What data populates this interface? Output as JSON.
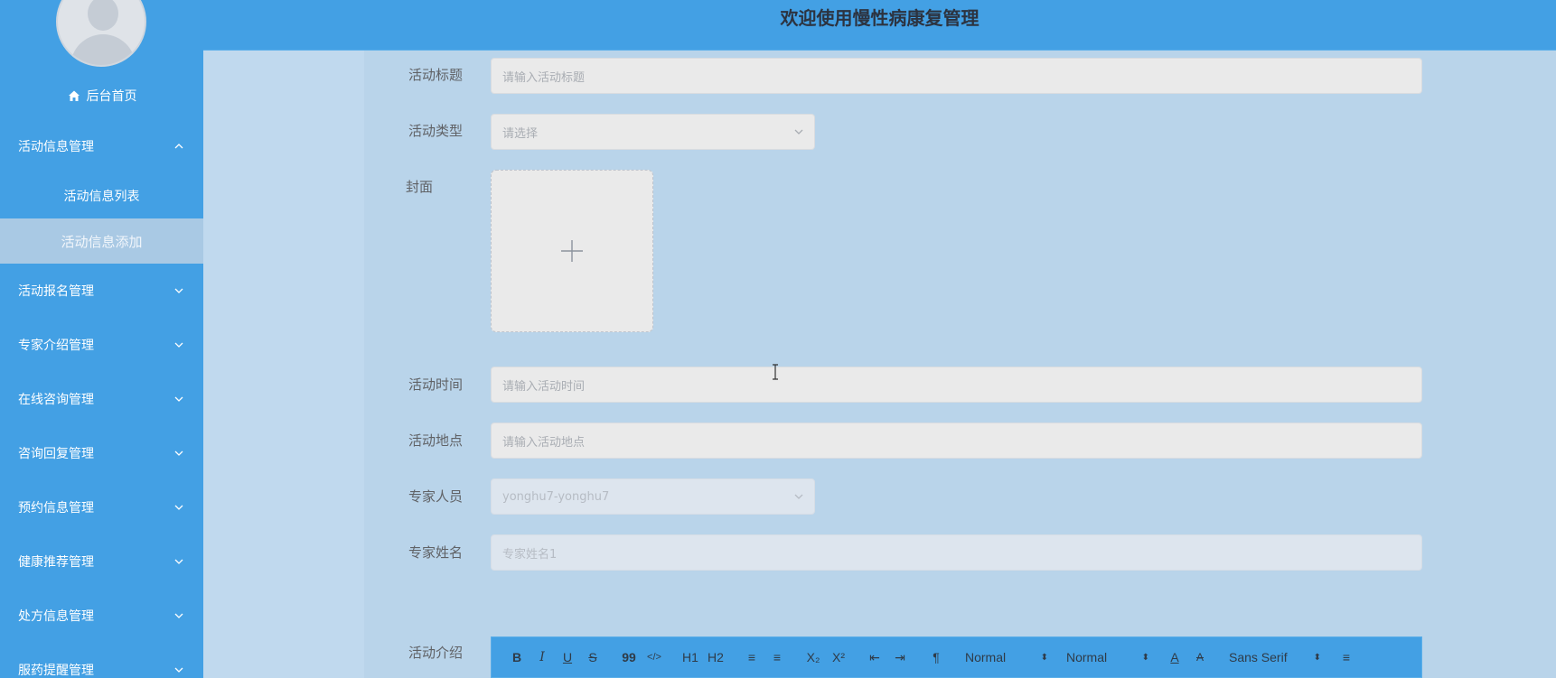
{
  "header": {
    "title": "欢迎使用慢性病康复管理"
  },
  "sidebar": {
    "home_label": "后台首页",
    "groups": [
      {
        "label": "活动信息管理",
        "expanded": true
      },
      {
        "label": "活动报名管理",
        "expanded": false
      },
      {
        "label": "专家介绍管理",
        "expanded": false
      },
      {
        "label": "在线咨询管理",
        "expanded": false
      },
      {
        "label": "咨询回复管理",
        "expanded": false
      },
      {
        "label": "预约信息管理",
        "expanded": false
      },
      {
        "label": "健康推荐管理",
        "expanded": false
      },
      {
        "label": "处方信息管理",
        "expanded": false
      },
      {
        "label": "服药提醒管理",
        "expanded": false
      }
    ],
    "sub_items": [
      {
        "label": "活动信息列表",
        "active": false
      },
      {
        "label": "活动信息添加",
        "active": true
      }
    ]
  },
  "form": {
    "title_label": "活动标题",
    "title_placeholder": "请输入活动标题",
    "type_label": "活动类型",
    "type_placeholder": "请选择",
    "cover_label": "封面",
    "time_label": "活动时间",
    "time_placeholder": "请输入活动时间",
    "location_label": "活动地点",
    "location_placeholder": "请输入活动地点",
    "expert_label": "专家人员",
    "expert_value": "yonghu7-yonghu7",
    "expert_name_label": "专家姓名",
    "expert_name_value": "专家姓名1",
    "intro_label": "活动介绍"
  },
  "editor": {
    "bold": "B",
    "italic": "I",
    "underline": "U",
    "strike": "S",
    "quote": "99",
    "code": "</>",
    "h1": "H1",
    "h2": "H2",
    "ol": "≡",
    "ul": "≡",
    "sub": "X₂",
    "sup": "X²",
    "outdent": "⇤",
    "indent": "⇥",
    "direction": "¶",
    "size_value": "Normal",
    "header_value": "Normal",
    "font_color": "A",
    "background": "A",
    "font_value": "Sans Serif",
    "align": "≡"
  },
  "colors": {
    "sidebar": "#43a0e4",
    "header": "#43a0e4",
    "content": "#b9d4ea",
    "active_sub": "#a9c9e4"
  }
}
